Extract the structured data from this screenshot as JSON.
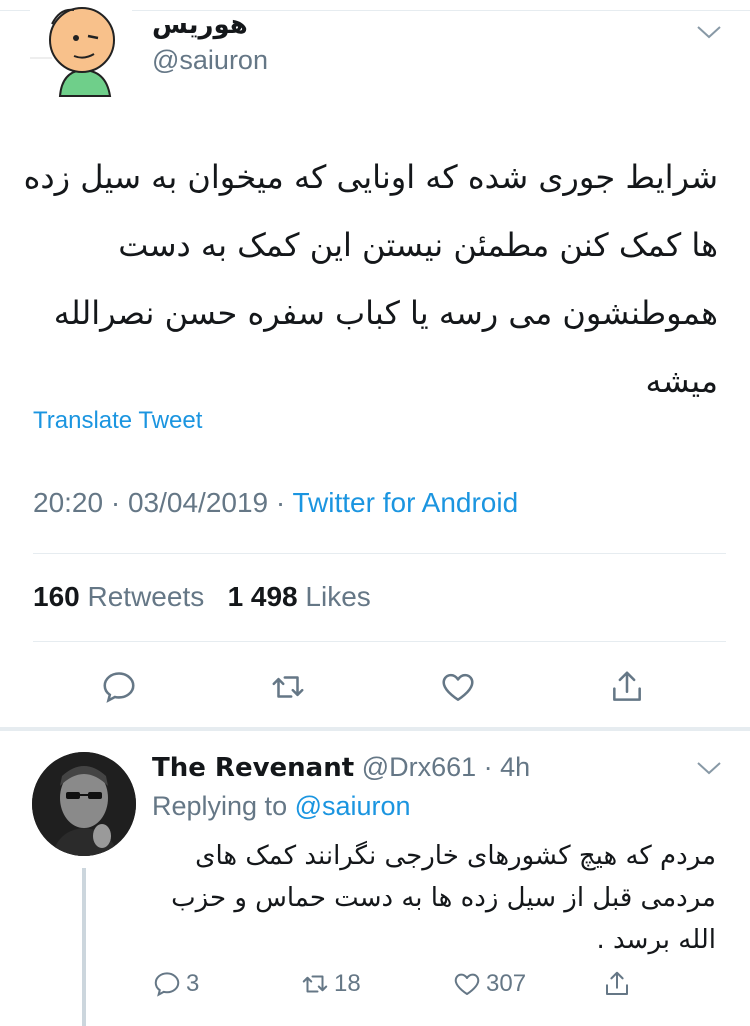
{
  "tweet": {
    "author_name": "هوریس",
    "author_handle": "@saiuron",
    "text": "شرایط جوری شده که اونایی که میخوان به سیل زده ها کمک کنن مطمئن نیستن این کمک به دست هموطنشون می رسه یا کباب سفره حسن نصرالله میشه",
    "translate_label": "Translate Tweet",
    "time": "20:20",
    "date": "03/04/2019",
    "source": "Twitter for Android",
    "retweets_count": "160",
    "retweets_label": "Retweets",
    "likes_count": "1 498",
    "likes_label": "Likes",
    "actions": [
      "reply-icon",
      "retweet-icon",
      "like-icon",
      "share-icon"
    ]
  },
  "reply": {
    "author_name": "The Revenant",
    "author_handle": "@Drx661",
    "age": "4h",
    "replying_label": "Replying to",
    "replying_to": "@saiuron",
    "text": "مردم که هیچ کشورهای خارجی نگرانند کمک های مردمی قبل از سیل زده ها به دست حماس و حزب الله برسد .",
    "reply_count": "3",
    "retweet_count": "18",
    "like_count": "307"
  },
  "colors": {
    "accent": "#1b95e0",
    "secondary_text": "#657786",
    "divider": "#e6ecf0"
  }
}
